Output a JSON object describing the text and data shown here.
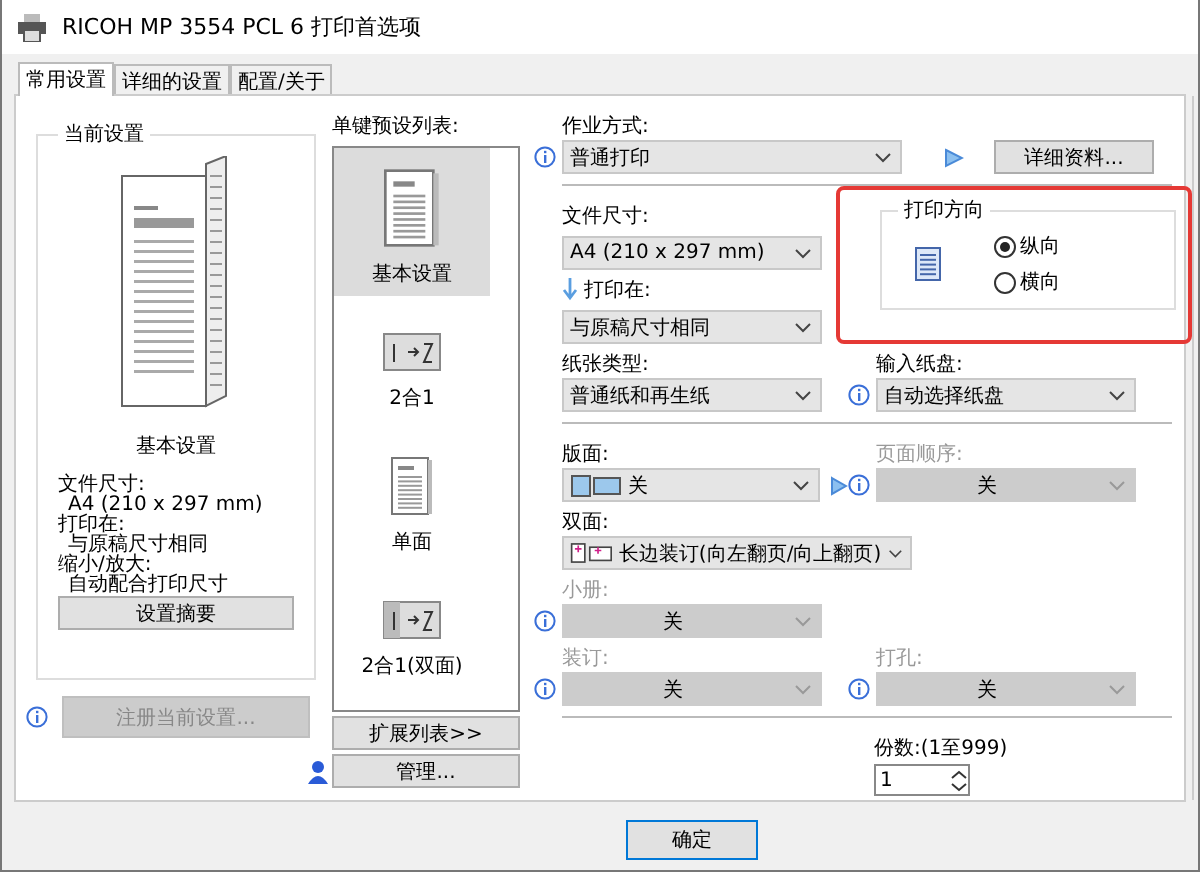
{
  "window": {
    "title": "RICOH MP 3554 PCL 6 打印首选项"
  },
  "tabs": [
    {
      "label": "常用设置",
      "selected": true
    },
    {
      "label": "详细的设置",
      "selected": false
    },
    {
      "label": "配置/关于",
      "selected": false
    }
  ],
  "current_settings": {
    "title": "当前设置",
    "preset_name": "基本设置",
    "details": [
      {
        "label": "文件尺寸:",
        "value": "A4 (210 x 297 mm)"
      },
      {
        "label": "打印在:",
        "value": "与原稿尺寸相同"
      },
      {
        "label": "缩小/放大:",
        "value": "自动配合打印尺寸"
      }
    ],
    "summary_button": "设置摘要"
  },
  "register_button": {
    "label": "注册当前设置...",
    "disabled": true
  },
  "preset_list": {
    "label": "单键预设列表:",
    "items": [
      {
        "label": "基本设置",
        "kind": "page",
        "selected": true
      },
      {
        "label": "2合1",
        "kind": "combine",
        "selected": false
      },
      {
        "label": "单面",
        "kind": "page",
        "selected": false
      },
      {
        "label": "2合1(双面)",
        "kind": "combine_duplex",
        "selected": false
      }
    ],
    "expand_button": "扩展列表>>",
    "manage_button": "管理..."
  },
  "job_type": {
    "label": "作业方式:",
    "value": "普通打印",
    "details_button": "详细资料..."
  },
  "paper_size": {
    "label": "文件尺寸:",
    "value": "A4 (210 x 297 mm)"
  },
  "print_on": {
    "label": "打印在:",
    "value": "与原稿尺寸相同"
  },
  "orientation": {
    "title": "打印方向",
    "options": [
      {
        "label": "纵向",
        "selected": true
      },
      {
        "label": "横向",
        "selected": false
      }
    ]
  },
  "paper_type": {
    "label": "纸张类型:",
    "value": "普通纸和再生纸"
  },
  "input_tray": {
    "label": "输入纸盘:",
    "value": "自动选择纸盘"
  },
  "layout": {
    "label": "版面:",
    "value": "关",
    "disabled": false
  },
  "page_order": {
    "label": "页面顺序:",
    "value": "关",
    "disabled": true
  },
  "duplex": {
    "label": "双面:",
    "value": "长边装订(向左翻页/向上翻页)"
  },
  "booklet": {
    "label": "小册:",
    "value": "关",
    "disabled": true
  },
  "staple": {
    "label": "装订:",
    "value": "关",
    "disabled": true
  },
  "punch": {
    "label": "打孔:",
    "value": "关",
    "disabled": true
  },
  "copies": {
    "label": "份数:(1至999)",
    "value": "1"
  },
  "footer_buttons": [
    "确定"
  ]
}
